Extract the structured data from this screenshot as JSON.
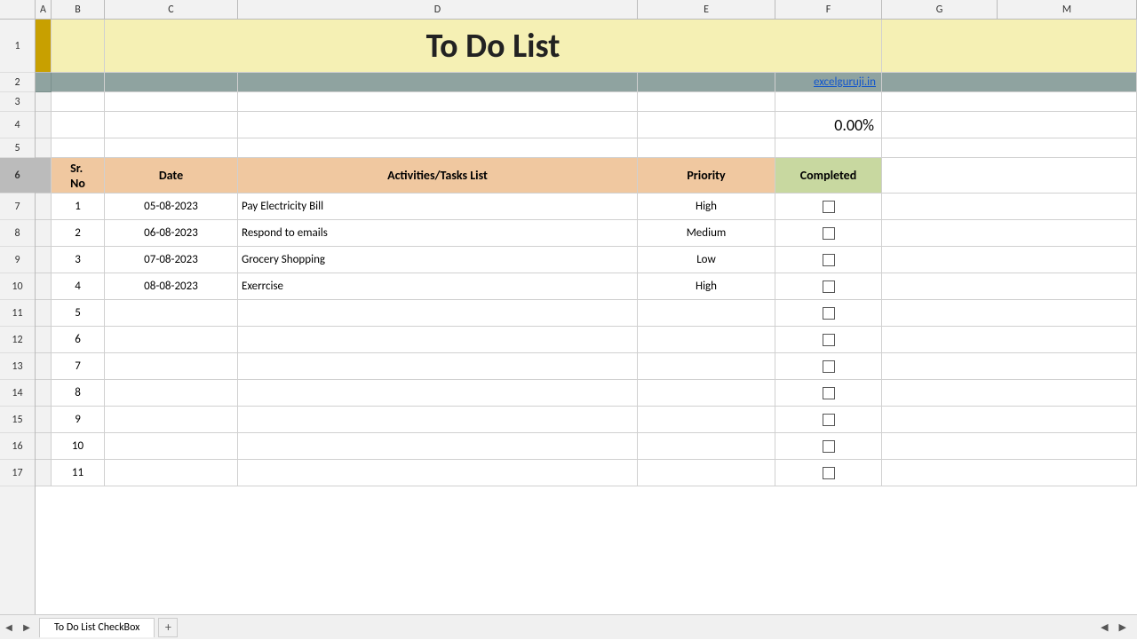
{
  "title": "To Do List",
  "website": "excelguruji.in",
  "progress": "0.00%",
  "columns": {
    "a": "A",
    "b": "B",
    "c": "C",
    "d": "D",
    "e": "E",
    "f": "F",
    "g": "G",
    "m": "M"
  },
  "header": {
    "sr_no": "Sr. No",
    "date": "Date",
    "tasks": "Activities/Tasks List",
    "priority": "Priority",
    "completed": "Completed"
  },
  "rows": [
    {
      "sr": "1",
      "date": "05-08-2023",
      "task": "Pay Electricity Bill",
      "priority": "High",
      "checked": false
    },
    {
      "sr": "2",
      "date": "06-08-2023",
      "task": "Respond to emails",
      "priority": "Medium",
      "checked": false
    },
    {
      "sr": "3",
      "date": "07-08-2023",
      "task": "Grocery Shopping",
      "priority": "Low",
      "checked": false
    },
    {
      "sr": "4",
      "date": "08-08-2023",
      "task": "Exerrcise",
      "priority": "High",
      "checked": false
    },
    {
      "sr": "5",
      "date": "",
      "task": "",
      "priority": "",
      "checked": false
    },
    {
      "sr": "6",
      "date": "",
      "task": "",
      "priority": "",
      "checked": false
    },
    {
      "sr": "7",
      "date": "",
      "task": "",
      "priority": "",
      "checked": false
    },
    {
      "sr": "8",
      "date": "",
      "task": "",
      "priority": "",
      "checked": false
    },
    {
      "sr": "9",
      "date": "",
      "task": "",
      "priority": "",
      "checked": false
    },
    {
      "sr": "10",
      "date": "",
      "task": "",
      "priority": "",
      "checked": false
    },
    {
      "sr": "11",
      "date": "",
      "task": "",
      "priority": "",
      "checked": false
    }
  ],
  "sheet_tab": "To Do List CheckBox",
  "row_numbers": [
    "1",
    "2",
    "3",
    "4",
    "5",
    "6",
    "7",
    "8",
    "9",
    "10",
    "11",
    "12",
    "13",
    "14",
    "15",
    "16",
    "17"
  ]
}
